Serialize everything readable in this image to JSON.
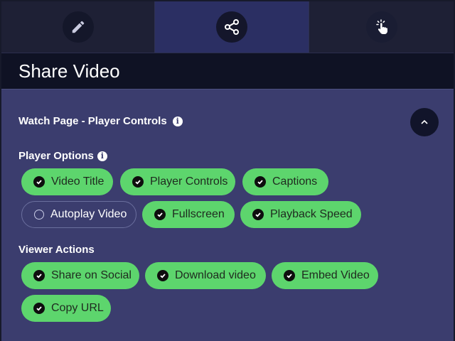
{
  "tabs": [
    {
      "icon": "pencil-icon"
    },
    {
      "icon": "share-icon",
      "active": true
    },
    {
      "icon": "tap-hand-icon"
    }
  ],
  "header": {
    "title": "Share Video"
  },
  "section": {
    "title": "Watch Page - Player Controls",
    "info_icon": "i",
    "expanded": true
  },
  "player_options": {
    "label": "Player Options",
    "info_icon": "i",
    "items": [
      {
        "label": "Video Title",
        "checked": true
      },
      {
        "label": "Player Controls",
        "checked": true
      },
      {
        "label": "Captions",
        "checked": true
      },
      {
        "label": "Autoplay Video",
        "checked": false
      },
      {
        "label": "Fullscreen",
        "checked": true
      },
      {
        "label": "Playback Speed",
        "checked": true
      }
    ]
  },
  "viewer_actions": {
    "label": "Viewer Actions",
    "items": [
      {
        "label": "Share on Social",
        "checked": true
      },
      {
        "label": "Download video",
        "checked": true
      },
      {
        "label": "Embed Video",
        "checked": true
      },
      {
        "label": "Copy URL",
        "checked": true
      }
    ]
  },
  "colors": {
    "accent": "#5dd56d",
    "background": "#3b3d6e",
    "header": "#0f1224"
  }
}
